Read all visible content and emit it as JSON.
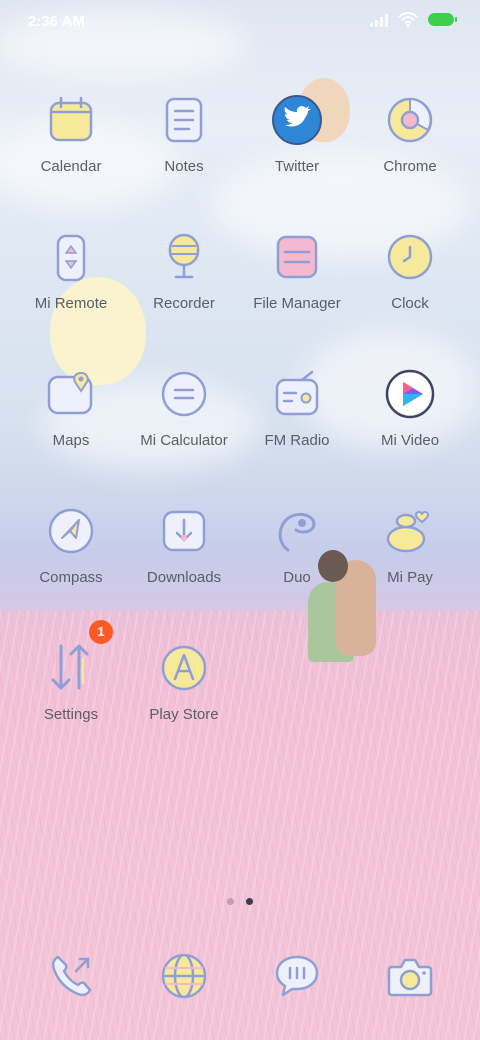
{
  "status_bar": {
    "time": "2:36 AM",
    "icons": [
      "signal-icon",
      "wifi-icon",
      "battery-charging-icon"
    ]
  },
  "colors": {
    "icon_stroke": "#8f9fd6",
    "icon_fill_yellow": "#f7e99a",
    "icon_fill_pink": "#f4b8cf",
    "label_text": "#5b5d67",
    "badge": "#ff5a26"
  },
  "apps": [
    {
      "label": "Calendar",
      "icon": "calendar-icon"
    },
    {
      "label": "Notes",
      "icon": "notes-icon"
    },
    {
      "label": "Twitter",
      "icon": "twitter-icon"
    },
    {
      "label": "Chrome",
      "icon": "chrome-icon"
    },
    {
      "label": "Mi Remote",
      "icon": "remote-icon"
    },
    {
      "label": "Recorder",
      "icon": "microphone-icon"
    },
    {
      "label": "File Manager",
      "icon": "folder-icon"
    },
    {
      "label": "Clock",
      "icon": "clock-icon"
    },
    {
      "label": "Maps",
      "icon": "map-pin-icon"
    },
    {
      "label": "Mi Calculator",
      "icon": "calculator-icon"
    },
    {
      "label": "FM Radio",
      "icon": "radio-icon"
    },
    {
      "label": "Mi Video",
      "icon": "play-icon"
    },
    {
      "label": "Compass",
      "icon": "compass-icon"
    },
    {
      "label": "Downloads",
      "icon": "download-icon"
    },
    {
      "label": "Duo",
      "icon": "duo-icon"
    },
    {
      "label": "Mi Pay",
      "icon": "wallet-icon"
    },
    {
      "label": "Settings",
      "icon": "settings-arrows-icon",
      "badge": "1"
    },
    {
      "label": "Play Store",
      "icon": "play-store-icon"
    }
  ],
  "page_indicator": {
    "count": 2,
    "active_index": 1
  },
  "dock": [
    {
      "icon": "phone-icon"
    },
    {
      "icon": "browser-globe-icon"
    },
    {
      "icon": "messages-icon"
    },
    {
      "icon": "camera-icon"
    }
  ]
}
